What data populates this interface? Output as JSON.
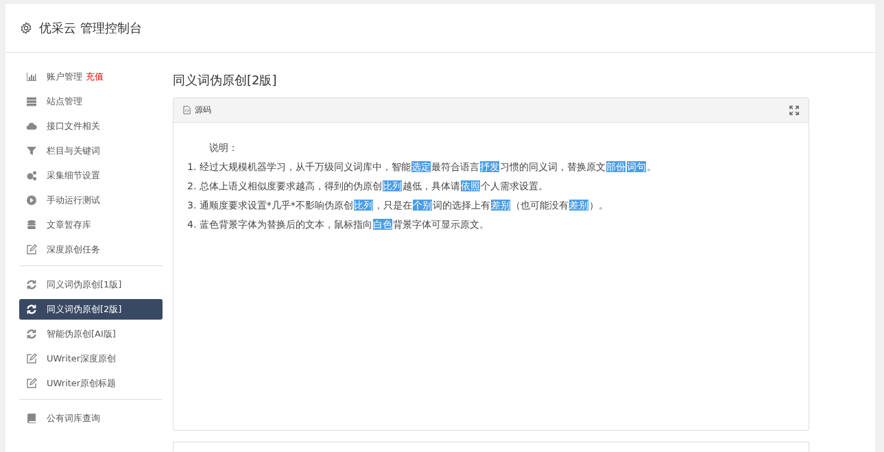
{
  "header": {
    "title": "优采云 管理控制台"
  },
  "sidebar": {
    "groups": [
      {
        "items": [
          {
            "kind": "chart",
            "label": "账户管理",
            "badge": "充值",
            "selected": false
          },
          {
            "kind": "server",
            "label": "站点管理",
            "selected": false
          },
          {
            "kind": "cloud",
            "label": "接口文件相关",
            "selected": false
          },
          {
            "kind": "filter",
            "label": "栏目与关键词",
            "selected": false
          },
          {
            "kind": "gears",
            "label": "采集细节设置",
            "selected": false
          },
          {
            "kind": "play",
            "label": "手动运行测试",
            "selected": false
          },
          {
            "kind": "database",
            "label": "文章暂存库",
            "selected": false
          },
          {
            "kind": "edit",
            "label": "深度原创任务",
            "selected": false
          }
        ]
      },
      {
        "items": [
          {
            "kind": "refresh",
            "label": "同义词伪原创[1版]",
            "selected": false
          },
          {
            "kind": "refresh",
            "label": "同义词伪原创[2版]",
            "selected": true
          },
          {
            "kind": "refresh",
            "label": "智能伪原创[AI版]",
            "selected": false
          },
          {
            "kind": "edit",
            "label": "UWriter深度原创",
            "selected": false
          },
          {
            "kind": "edit",
            "label": "UWriter原创标题",
            "selected": false
          }
        ]
      },
      {
        "items": [
          {
            "kind": "book",
            "label": "公有词库查询",
            "selected": false
          }
        ]
      }
    ]
  },
  "page_title": "同义词伪原创[2版]",
  "editor": {
    "toolbar_label": "源码",
    "heading": "说明：",
    "lines": [
      [
        {
          "t": "1. 经过大规模机器学习，从千万级同义词库中，智能",
          "hl": false
        },
        {
          "t": "选定",
          "hl": true
        },
        {
          "t": "最符合语言",
          "hl": false
        },
        {
          "t": "抒发",
          "hl": true
        },
        {
          "t": "习惯的同义词，替换原文",
          "hl": false
        },
        {
          "t": "部份",
          "hl": true
        },
        {
          "t": "词句",
          "hl": true
        },
        {
          "t": "。",
          "hl": false
        }
      ],
      [
        {
          "t": "2. 总体上语义相似度要求越高，得到的伪原创",
          "hl": false
        },
        {
          "t": "比列",
          "hl": true
        },
        {
          "t": "越低，具体请",
          "hl": false
        },
        {
          "t": "依照",
          "hl": true
        },
        {
          "t": "个人需求设置。",
          "hl": false
        }
      ],
      [
        {
          "t": "3. 通顺度要求设置*几乎*不影响伪原创",
          "hl": false
        },
        {
          "t": "比列",
          "hl": true
        },
        {
          "t": "，只是在",
          "hl": false
        },
        {
          "t": "个别",
          "hl": true
        },
        {
          "t": "词的选择上有",
          "hl": false
        },
        {
          "t": "差别",
          "hl": true
        },
        {
          "t": "（也可能没有",
          "hl": false
        },
        {
          "t": "差别",
          "hl": true
        },
        {
          "t": "）。",
          "hl": false
        }
      ],
      [
        {
          "t": "4. 蓝色背景字体为替换后的文本，鼠标指向",
          "hl": false
        },
        {
          "t": "白色",
          "hl": true
        },
        {
          "t": "背景字体可显示原文。",
          "hl": false
        }
      ]
    ]
  }
}
